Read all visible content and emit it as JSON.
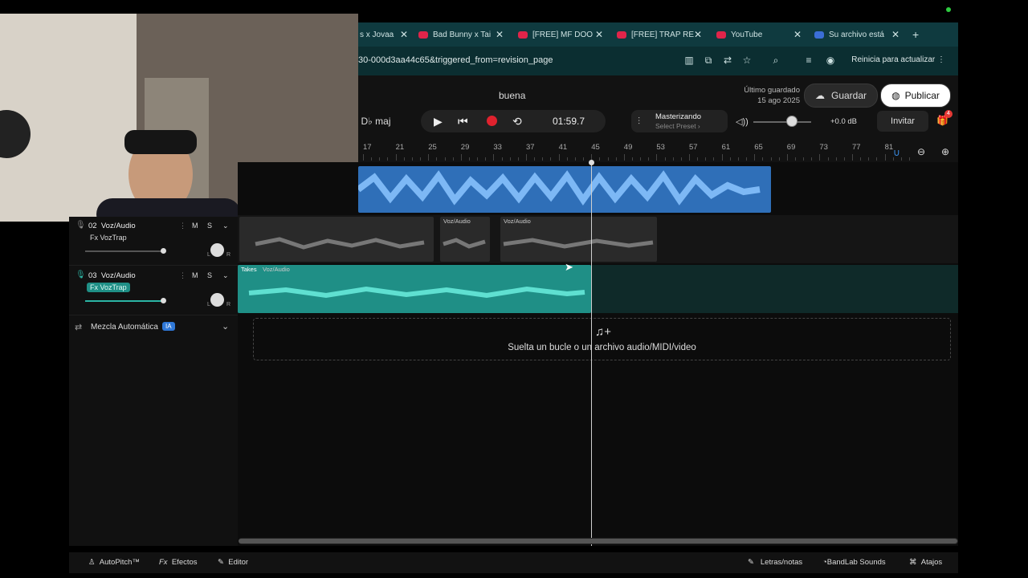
{
  "browser": {
    "tabs": [
      {
        "label": "s x Jovaa",
        "icon": "youtube-icon"
      },
      {
        "label": "Bad Bunny x Tai",
        "icon": "youtube-icon"
      },
      {
        "label": "[FREE] MF DOO",
        "icon": "youtube-icon"
      },
      {
        "label": "[FREE] TRAP RE",
        "icon": "youtube-icon"
      },
      {
        "label": "YouTube",
        "icon": "youtube-icon"
      },
      {
        "label": "Su archivo está",
        "icon": "bandlab-icon"
      }
    ],
    "new_tab": "+",
    "url": "30-000d3aa44c65&triggered_from=revision_page",
    "restart_label": "Reinicia para actualizar"
  },
  "daw": {
    "project_name": "buena",
    "saved_label": "Último guardado",
    "saved_date": "15 ago 2025",
    "save_label": "Guardar",
    "publish_label": "Publicar",
    "key": "D♭ maj",
    "time": "01:59.7",
    "mastering_label": "Masterizando",
    "preset_label": "Select Preset ›",
    "db_value": "+0.0 dB",
    "volume_level": 0.6,
    "invite_label": "Invitar",
    "gift_badge": "4",
    "ruler": [
      "17",
      "21",
      "25",
      "29",
      "33",
      "37",
      "41",
      "45",
      "49",
      "53",
      "57",
      "61",
      "65",
      "69",
      "73",
      "77",
      "81"
    ]
  },
  "tracks": [
    {
      "number": "02",
      "name": "Voz/Audio",
      "fx": "Fx VozTrap",
      "mute": "M",
      "solo": "S",
      "l": "L",
      "r": "R"
    },
    {
      "number": "03",
      "name": "Voz/Audio",
      "fx": "Fx VozTrap",
      "mute": "M",
      "solo": "S",
      "l": "L",
      "r": "R"
    }
  ],
  "auto_mix": {
    "label": "Mezcla Automática",
    "badge": "IA"
  },
  "clips": {
    "track2_a": "Voz/Audio",
    "track2_b": "Voz/Audio",
    "track3_takes": "Takes",
    "track3_name": "Voz/Audio"
  },
  "dropzone": "Suelta un bucle o un archivo audio/MIDI/video",
  "footer": {
    "autopitch": "AutoPitch™",
    "effects": "Efectos",
    "editor": "Editor",
    "lyrics": "Letras/notas",
    "sounds": "BandLab Sounds",
    "shortcuts": "Atajos"
  },
  "colors": {
    "accent_teal": "#2bb5a4",
    "master_blue": "#3a8ee6",
    "record_red": "#e0222e"
  }
}
